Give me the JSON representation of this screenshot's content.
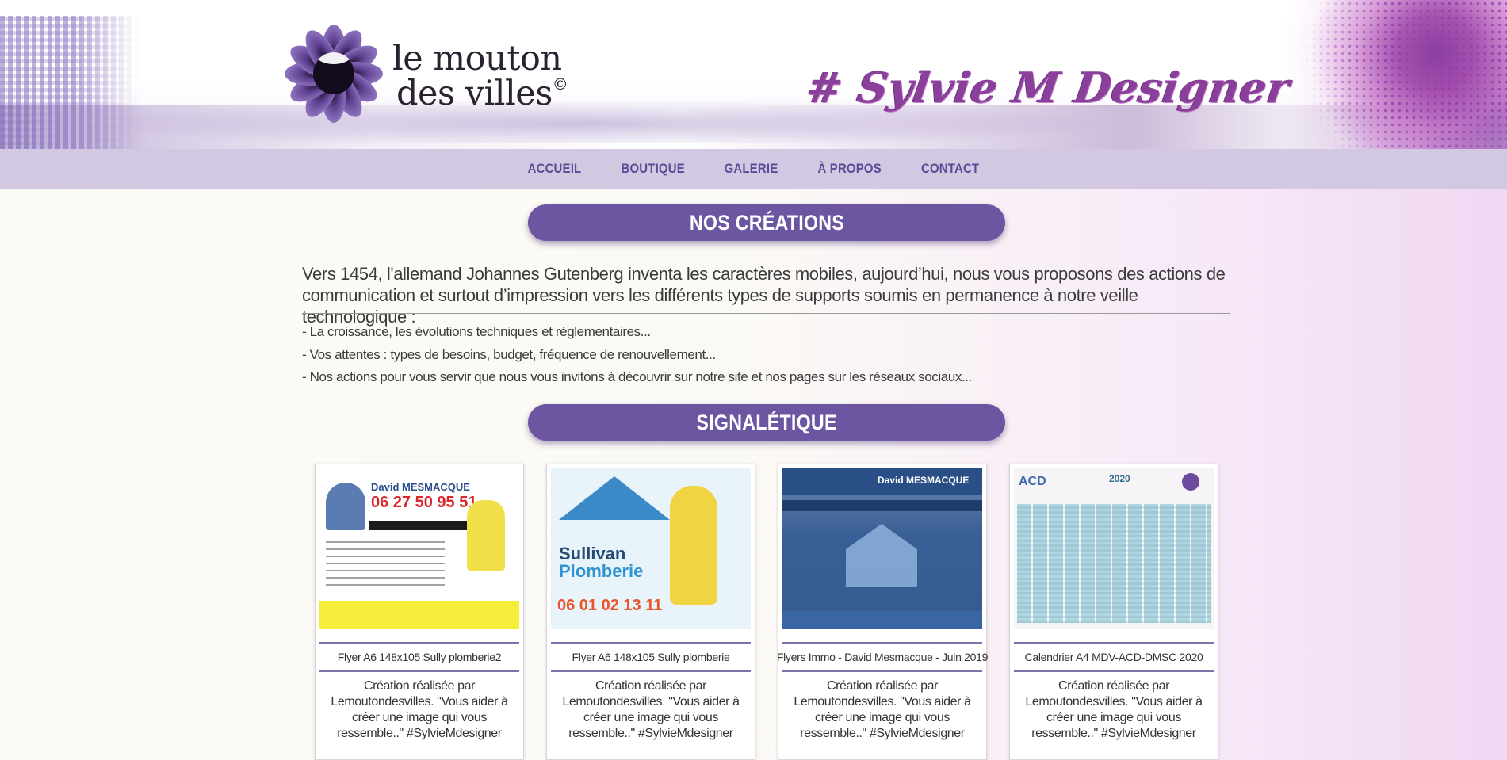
{
  "header": {
    "logo_line1": "le mouton",
    "logo_line2": "des villes",
    "logo_mark": "©",
    "tagline": "# Sylvie M Designer"
  },
  "nav": {
    "items": [
      {
        "label": "ACCUEIL"
      },
      {
        "label": "BOUTIQUE"
      },
      {
        "label": "GALERIE"
      },
      {
        "label": "À PROPOS"
      },
      {
        "label": "CONTACT"
      }
    ]
  },
  "sections": {
    "creations_title": "NOS CRÉATIONS",
    "signaletique_title": "SIGNALÉTIQUE"
  },
  "intro": {
    "paragraph": "Vers 1454, l'allemand Johannes Gutenberg inventa les caractères mobiles, aujourd’hui, nous vous proposons des actions de communication et surtout d’impression vers les différents types de supports soumis en permanence à notre veille technologique :",
    "bullets": [
      "- La croissance, les évolutions techniques et réglementaires...",
      "- Vos attentes : types de besoins, budget, fréquence de renouvellement...",
      "- Nos actions pour vous servir que nous vous invitons à découvrir sur notre site et nos pages sur les réseaux sociaux..."
    ]
  },
  "cards": [
    {
      "title": "Flyer A6 148x105 Sully plomberie2",
      "description": "Création réalisée par Lemoutondesvilles. \"Vous aider à créer une image qui vous ressemble..\" #SylvieMdesigner",
      "thumb": {
        "name": "David MESMACQUE",
        "phone": "06 27 50 95 51"
      }
    },
    {
      "title": "Flyer A6 148x105 Sully plomberie",
      "description": "Création réalisée par Lemoutondesvilles. \"Vous aider à créer une image qui vous ressemble..\" #SylvieMdesigner",
      "thumb": {
        "line1": "Sullivan",
        "line2": "Plomberie",
        "phone": "06 01 02 13 11"
      }
    },
    {
      "title": "Flyers Immo - David Mesmacque - Juin 2019",
      "description": "Création réalisée par Lemoutondesvilles. \"Vous aider à créer une image qui vous ressemble..\" #SylvieMdesigner",
      "thumb": {
        "name": "David MESMACQUE"
      }
    },
    {
      "title": "Calendrier A4 MDV-ACD-DMSC 2020",
      "description": "Création réalisée par Lemoutondesvilles. \"Vous aider à créer une image qui vous ressemble..\" #SylvieMdesigner",
      "thumb": {
        "badge": "ACD",
        "year": "2020"
      }
    }
  ],
  "colors": {
    "accent": "#6c55a1",
    "nav_bg": "#d2c8e2",
    "nav_text": "#5b4a95"
  }
}
